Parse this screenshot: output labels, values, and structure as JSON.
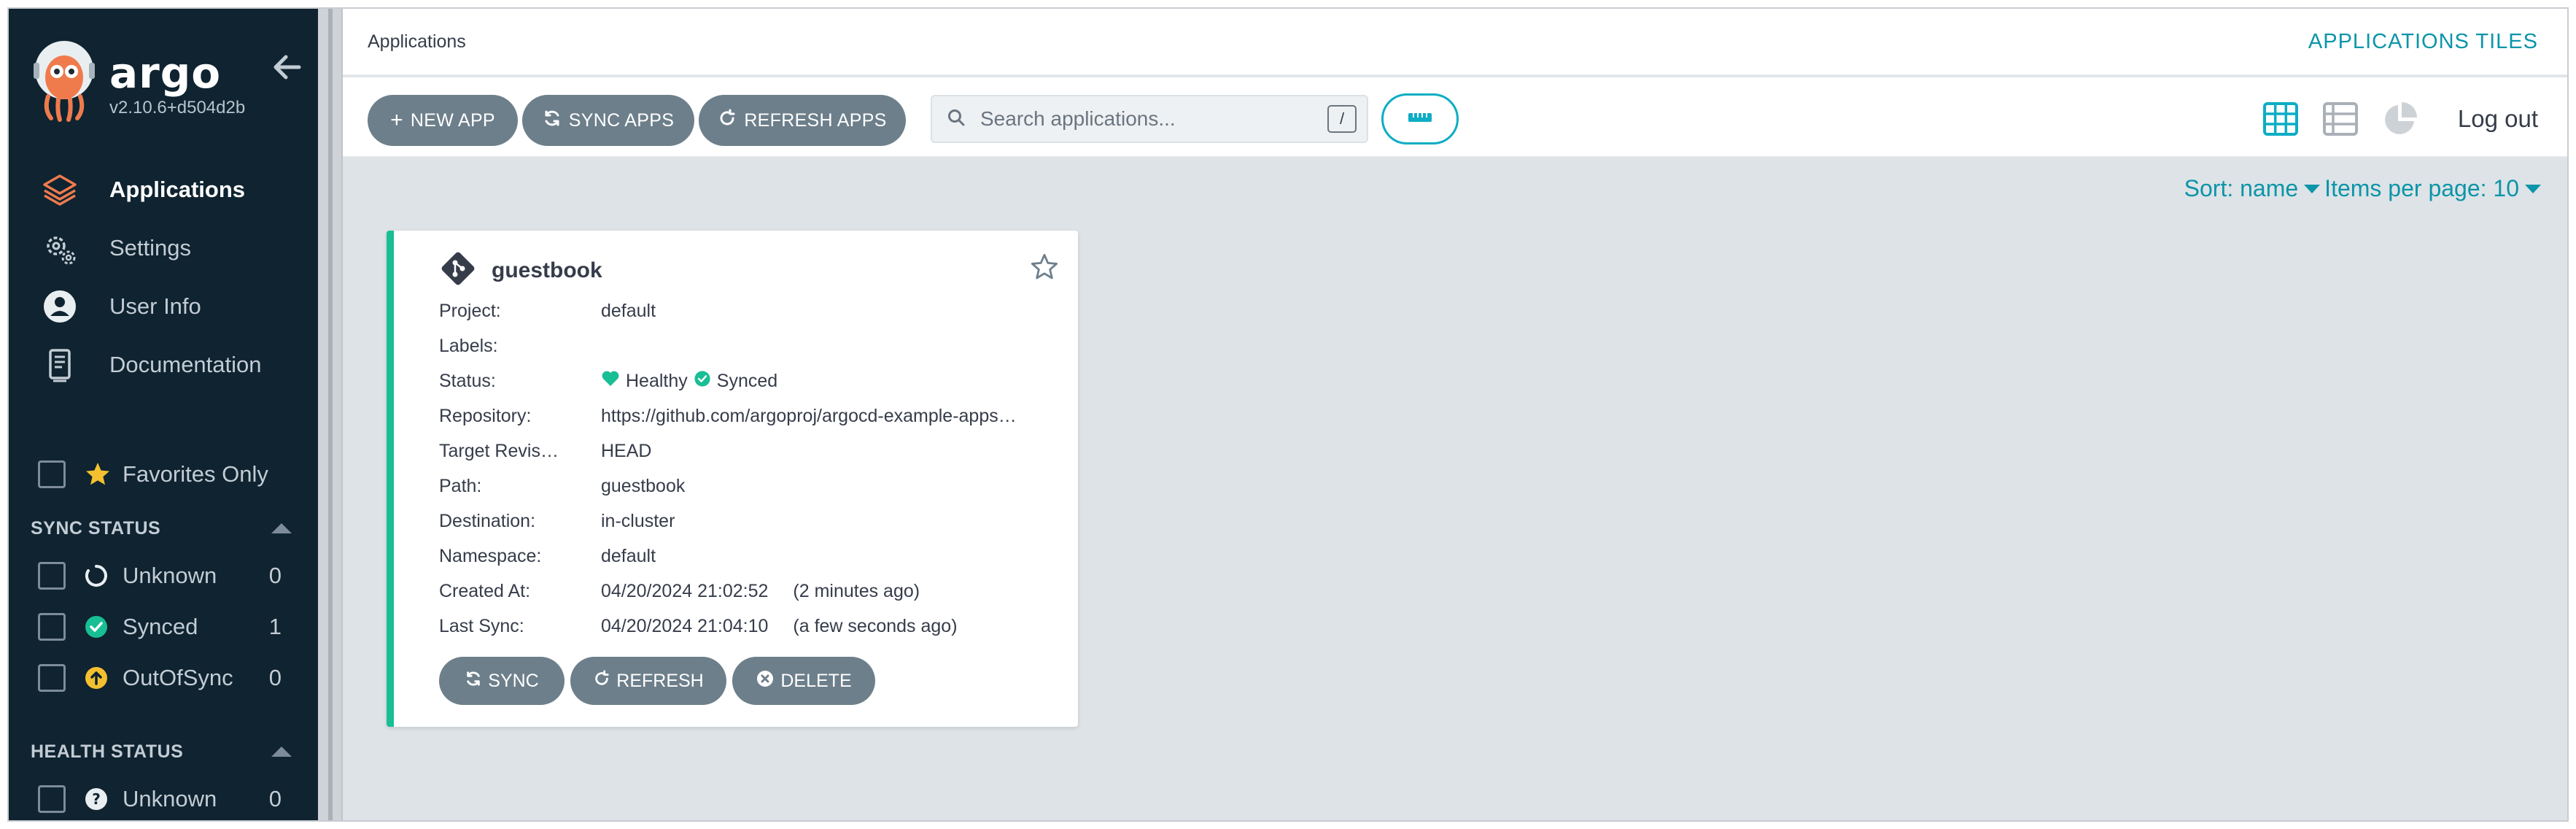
{
  "app": {
    "brand_name": "argo",
    "version": "v2.10.6+d504d2b"
  },
  "sidebar": {
    "nav": [
      {
        "label": "Applications",
        "icon": "layers-icon",
        "active": true
      },
      {
        "label": "Settings",
        "icon": "gears-icon",
        "active": false
      },
      {
        "label": "User Info",
        "icon": "user-circle-icon",
        "active": false
      },
      {
        "label": "Documentation",
        "icon": "book-icon",
        "active": false
      }
    ],
    "favorites_label": "Favorites Only",
    "sync_status": {
      "title": "SYNC STATUS",
      "items": [
        {
          "label": "Unknown",
          "count": "0",
          "icon": "circle-notch-icon"
        },
        {
          "label": "Synced",
          "count": "1",
          "icon": "check-circle-icon"
        },
        {
          "label": "OutOfSync",
          "count": "0",
          "icon": "arrow-up-circle-icon"
        }
      ]
    },
    "health_status": {
      "title": "HEALTH STATUS",
      "items": [
        {
          "label": "Unknown",
          "count": "0",
          "icon": "question-circle-icon"
        }
      ]
    }
  },
  "header": {
    "breadcrumb": "Applications",
    "page_kind": "APPLICATIONS TILES"
  },
  "toolbar": {
    "new_app": "NEW APP",
    "sync_apps": "SYNC APPS",
    "refresh_apps": "REFRESH APPS",
    "search_placeholder": "Search applications...",
    "search_shortcut": "/",
    "logout": "Log out"
  },
  "sort": {
    "sort_label": "Sort: name",
    "per_page_label": "Items per page: 10"
  },
  "application": {
    "name": "guestbook",
    "fields": {
      "project": {
        "key": "Project:",
        "value": "default"
      },
      "labels": {
        "key": "Labels:",
        "value": ""
      },
      "status": {
        "key": "Status:",
        "health": "Healthy",
        "sync": "Synced"
      },
      "repository": {
        "key": "Repository:",
        "value": "https://github.com/argoproj/argocd-example-apps…"
      },
      "target_revision": {
        "key": "Target Revis…",
        "value": "HEAD"
      },
      "path": {
        "key": "Path:",
        "value": "guestbook"
      },
      "destination": {
        "key": "Destination:",
        "value": "in-cluster"
      },
      "namespace": {
        "key": "Namespace:",
        "value": "default"
      },
      "created_at": {
        "key": "Created At:",
        "value": "04/20/2024 21:02:52",
        "relative": "(2 minutes ago)"
      },
      "last_sync": {
        "key": "Last Sync:",
        "value": "04/20/2024 21:04:10",
        "relative": "(a few seconds ago)"
      }
    },
    "actions": {
      "sync": "SYNC",
      "refresh": "REFRESH",
      "delete": "DELETE"
    }
  },
  "colors": {
    "sidebar_bg": "#0f2330",
    "accent_teal": "#0c95a9",
    "healthy_green": "#18be94",
    "outofsync_yellow": "#f4c030",
    "button_gray": "#6d7f8b",
    "main_bg": "#dee3e7"
  }
}
